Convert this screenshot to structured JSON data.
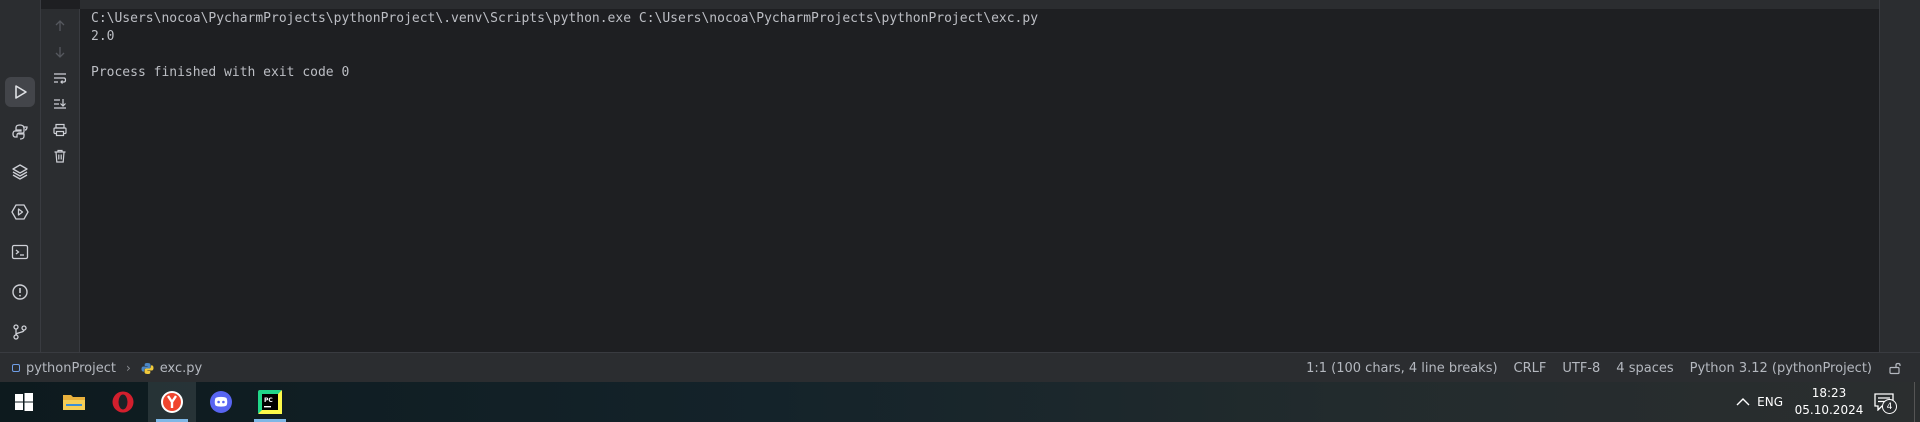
{
  "console": {
    "lines": [
      "C:\\Users\\nocoa\\PycharmProjects\\pythonProject\\.venv\\Scripts\\python.exe C:\\Users\\nocoa\\PycharmProjects\\pythonProject\\exc.py",
      "2.0",
      "",
      "Process finished with exit code 0"
    ]
  },
  "statusbar": {
    "project": "pythonProject",
    "file": "exc.py",
    "position": "1:1 (100 chars, 4 line breaks)",
    "line_separator": "CRLF",
    "encoding": "UTF-8",
    "indent": "4 spaces",
    "interpreter": "Python 3.12 (pythonProject)"
  },
  "taskbar": {
    "language": "ENG",
    "time": "18:23",
    "date": "05.10.2024",
    "notification_count": "4"
  },
  "icons": {
    "left_toolbar": [
      "run-icon",
      "python-console-icon",
      "layers-icon",
      "services-icon",
      "terminal-icon",
      "problems-icon",
      "git-icon"
    ],
    "run_tools": [
      "rerun-up-icon",
      "rerun-down-icon",
      "soft-wrap-icon",
      "scroll-to-end-icon",
      "print-icon",
      "clear-icon"
    ],
    "taskbar_apps": [
      "windows-start-icon",
      "file-explorer-icon",
      "opera-icon",
      "yandex-browser-icon",
      "discord-icon",
      "pycharm-icon"
    ]
  },
  "colors": {
    "background": "#1e1f22",
    "panel": "#2b2d30",
    "text": "#bcbec4",
    "accent": "#6f9ee6"
  }
}
